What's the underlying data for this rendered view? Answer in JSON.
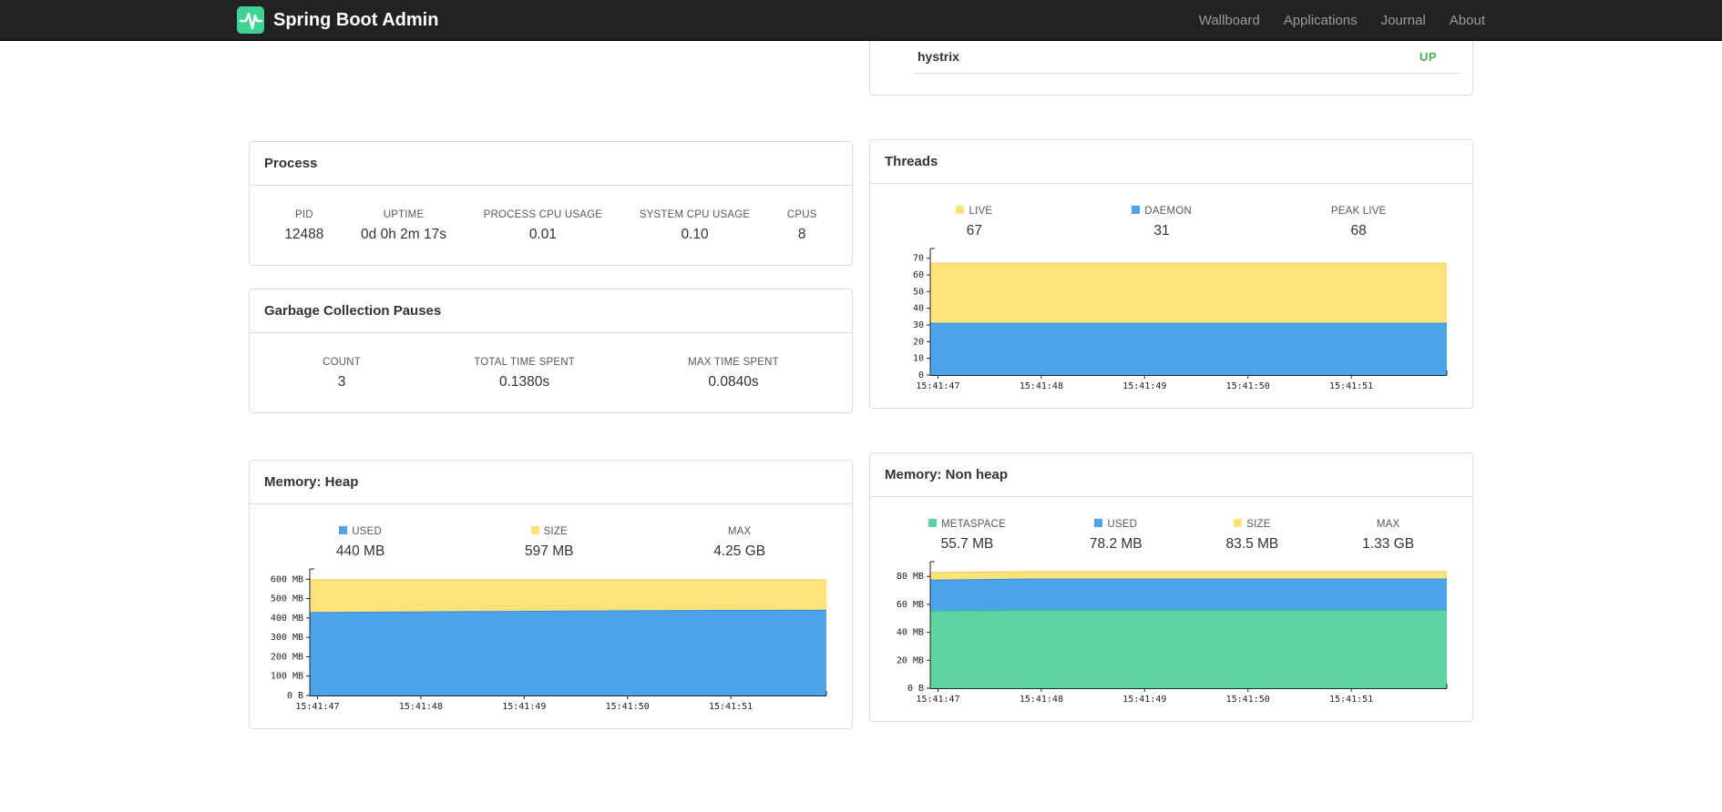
{
  "navbar": {
    "brand": "Spring Boot Admin",
    "items": [
      {
        "label": "Wallboard"
      },
      {
        "label": "Applications"
      },
      {
        "label": "Journal"
      },
      {
        "label": "About"
      }
    ]
  },
  "colors": {
    "brand_green": "#3ed295",
    "status_up": "#4caf50",
    "chart_blue": "#4da4e8",
    "chart_yellow": "#ffe27a",
    "chart_green": "#5fd4a2"
  },
  "application": {
    "name": "hystrix",
    "status": "UP",
    "status_color": "#4caf50"
  },
  "panels": {
    "process": {
      "title": "Process",
      "stats": [
        {
          "label": "PID",
          "value": "12488"
        },
        {
          "label": "UPTIME",
          "value": "0d 0h 2m 17s"
        },
        {
          "label": "PROCESS CPU USAGE",
          "value": "0.01"
        },
        {
          "label": "SYSTEM CPU USAGE",
          "value": "0.10"
        },
        {
          "label": "CPUS",
          "value": "8"
        }
      ]
    },
    "gc": {
      "title": "Garbage Collection Pauses",
      "stats": [
        {
          "label": "COUNT",
          "value": "3"
        },
        {
          "label": "TOTAL TIME SPENT",
          "value": "0.1380s"
        },
        {
          "label": "MAX TIME SPENT",
          "value": "0.0840s"
        }
      ]
    },
    "threads": {
      "title": "Threads",
      "stats": [
        {
          "label": "LIVE",
          "value": "67",
          "swatch": "#ffe27a"
        },
        {
          "label": "DAEMON",
          "value": "31",
          "swatch": "#4da4e8"
        },
        {
          "label": "PEAK LIVE",
          "value": "68"
        }
      ]
    },
    "heap": {
      "title": "Memory: Heap",
      "stats": [
        {
          "label": "USED",
          "value": "440 MB",
          "swatch": "#4da4e8"
        },
        {
          "label": "SIZE",
          "value": "597 MB",
          "swatch": "#ffe27a"
        },
        {
          "label": "MAX",
          "value": "4.25 GB"
        }
      ]
    },
    "nonheap": {
      "title": "Memory: Non heap",
      "stats": [
        {
          "label": "METASPACE",
          "value": "55.7 MB",
          "swatch": "#5fd4a2"
        },
        {
          "label": "USED",
          "value": "78.2 MB",
          "swatch": "#4da4e8"
        },
        {
          "label": "SIZE",
          "value": "83.5 MB",
          "swatch": "#ffe27a"
        },
        {
          "label": "MAX",
          "value": "1.33 GB"
        }
      ]
    }
  },
  "chart_data": [
    {
      "id": "threads",
      "type": "area",
      "title": "Threads",
      "ylim": [
        0,
        72
      ],
      "yticks": [
        0,
        10,
        20,
        30,
        40,
        50,
        60,
        70
      ],
      "ytick_labels": [
        "0",
        "10",
        "20",
        "30",
        "40",
        "50",
        "60",
        "70"
      ],
      "x_tick_labels": [
        "15:41:47",
        "15:41:48",
        "15:41:49",
        "15:41:50",
        "15:41:51"
      ],
      "x_tick_fractions": [
        0.015,
        0.215,
        0.415,
        0.615,
        0.815
      ],
      "x_fractions": [
        0,
        0.2,
        0.4,
        0.6,
        0.8,
        1
      ],
      "legend_position": "top",
      "grid": false,
      "series": [
        {
          "name": "LIVE",
          "color": "#ffe27a",
          "stroke": "#edca4f",
          "values": [
            67,
            67,
            67,
            67,
            67,
            67
          ]
        },
        {
          "name": "DAEMON",
          "color": "#4da4e8",
          "stroke": "#2e8fd8",
          "values": [
            31,
            31,
            31,
            31,
            31,
            31
          ]
        }
      ]
    },
    {
      "id": "heap",
      "type": "area",
      "title": "Memory: Heap",
      "ylim": [
        0,
        620
      ],
      "yticks": [
        0,
        100,
        200,
        300,
        400,
        500,
        600
      ],
      "ytick_labels": [
        "0 B",
        "100 MB",
        "200 MB",
        "300 MB",
        "400 MB",
        "500 MB",
        "600 MB"
      ],
      "x_tick_labels": [
        "15:41:47",
        "15:41:48",
        "15:41:49",
        "15:41:50",
        "15:41:51"
      ],
      "x_tick_fractions": [
        0.015,
        0.215,
        0.415,
        0.615,
        0.815
      ],
      "x_fractions": [
        0,
        0.2,
        0.4,
        0.6,
        0.8,
        1
      ],
      "legend_position": "top",
      "grid": false,
      "series": [
        {
          "name": "SIZE",
          "color": "#ffe27a",
          "stroke": "#edca4f",
          "values": [
            597,
            597,
            597,
            597,
            597,
            597
          ]
        },
        {
          "name": "USED",
          "color": "#4da4e8",
          "stroke": "#2e8fd8",
          "values": [
            428,
            431,
            434,
            437,
            439,
            440
          ]
        }
      ]
    },
    {
      "id": "nonheap",
      "type": "area",
      "title": "Memory: Non heap",
      "ylim": [
        0,
        86
      ],
      "yticks": [
        0,
        20,
        40,
        60,
        80
      ],
      "ytick_labels": [
        "0 B",
        "20 MB",
        "40 MB",
        "60 MB",
        "80 MB"
      ],
      "x_tick_labels": [
        "15:41:47",
        "15:41:48",
        "15:41:49",
        "15:41:50",
        "15:41:51"
      ],
      "x_tick_fractions": [
        0.015,
        0.215,
        0.415,
        0.615,
        0.815
      ],
      "x_fractions": [
        0,
        0.2,
        0.4,
        0.6,
        0.8,
        1
      ],
      "legend_position": "top",
      "grid": false,
      "series": [
        {
          "name": "SIZE",
          "color": "#ffe27a",
          "stroke": "#edca4f",
          "values": [
            82.8,
            83.5,
            83.5,
            83.5,
            83.5,
            83.5
          ]
        },
        {
          "name": "USED",
          "color": "#4da4e8",
          "stroke": "#2e8fd8",
          "values": [
            77.4,
            78.2,
            78.2,
            78.2,
            78.2,
            78.2
          ]
        },
        {
          "name": "METASPACE",
          "color": "#5fd4a2",
          "stroke": "#3cbd87",
          "values": [
            55.2,
            55.7,
            55.7,
            55.7,
            55.7,
            55.7
          ]
        }
      ]
    }
  ]
}
